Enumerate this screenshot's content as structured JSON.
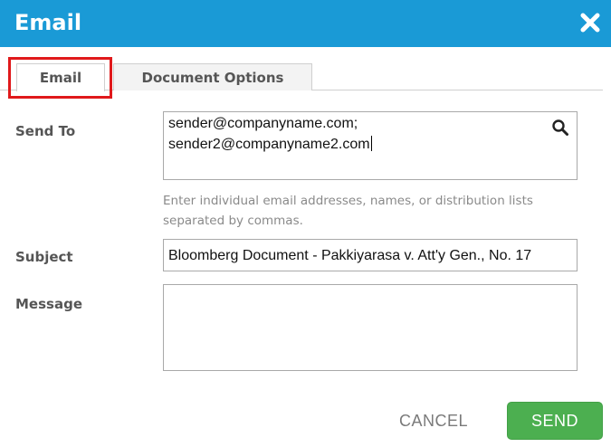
{
  "dialog": {
    "title": "Email",
    "close_icon": "close-icon"
  },
  "tabs": [
    {
      "label": "Email",
      "active": true
    },
    {
      "label": "Document Options",
      "active": false
    }
  ],
  "form": {
    "send_to": {
      "label": "Send To",
      "lines": [
        "sender@companyname.com;",
        "sender2@companyname2.com"
      ],
      "icon": "search-icon",
      "hint": "Enter individual email addresses, names, or distribution lists separated by commas."
    },
    "subject": {
      "label": "Subject",
      "value": "Bloomberg Document - Pakkiyarasa v. Att'y Gen., No. 17"
    },
    "message": {
      "label": "Message",
      "value": ""
    }
  },
  "buttons": {
    "cancel": "CANCEL",
    "send": "SEND"
  },
  "colors": {
    "titlebar": "#1a9ad6",
    "send_button": "#4caf50",
    "highlight": "#e0191b"
  }
}
